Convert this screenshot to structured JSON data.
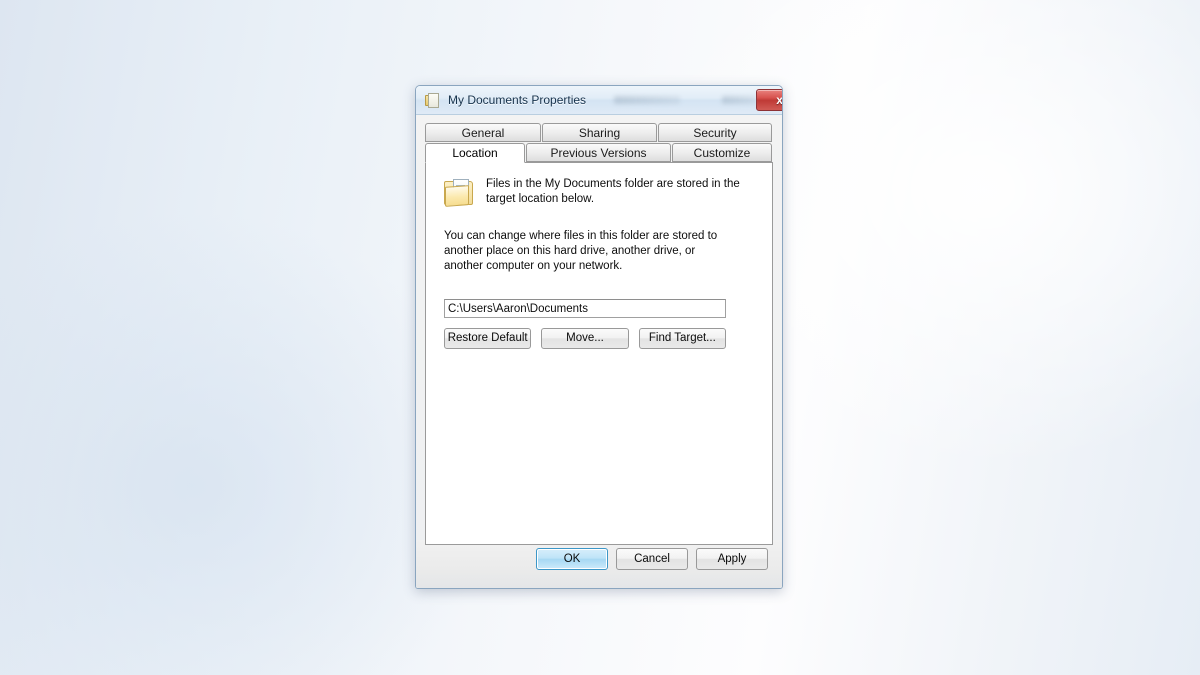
{
  "window": {
    "title": "My Documents Properties",
    "icon": "folder-document-icon",
    "close_label": "x"
  },
  "tabs": {
    "row1": [
      {
        "label": "General",
        "active": false
      },
      {
        "label": "Sharing",
        "active": false
      },
      {
        "label": "Security",
        "active": false
      }
    ],
    "row2": [
      {
        "label": "Location",
        "active": true
      },
      {
        "label": "Previous Versions",
        "active": false
      },
      {
        "label": "Customize",
        "active": false
      }
    ]
  },
  "location_tab": {
    "icon": "open-folder-icon",
    "description": "Files in the My Documents folder are stored in the target location below.",
    "explanation": "You can change where files in this folder are stored to another place on this hard drive, another drive, or another computer on your network.",
    "path_value": "C:\\Users\\Aaron\\Documents",
    "path_placeholder": "",
    "buttons": {
      "restore": "Restore Default",
      "move": "Move...",
      "find": "Find Target..."
    }
  },
  "footer": {
    "ok": "OK",
    "cancel": "Cancel",
    "apply": "Apply"
  },
  "colors": {
    "titlebar_start": "#eef5fb",
    "titlebar_end": "#dfeaf6",
    "close_red": "#bf3a36",
    "default_button_blue": "#a7d8f3",
    "panel_white": "#ffffff",
    "dialog_gray": "#f0f0f0"
  }
}
